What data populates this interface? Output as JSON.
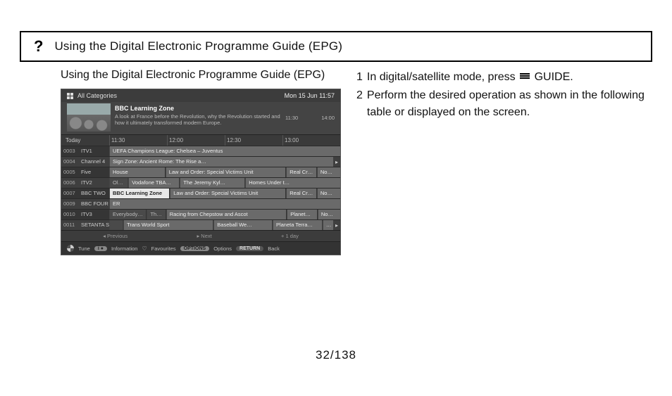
{
  "title_bar": {
    "icon_label": "?",
    "title": "Using the Digital Electronic Programme Guide (EPG)"
  },
  "subtitle": "Using the Digital Electronic Programme Guide (EPG)",
  "instructions": {
    "step1_num": "1",
    "step1_text_a": "In digital/satellite mode, press",
    "step1_text_b": "GUIDE.",
    "step2_num": "2",
    "step2_text": "Perform the desired operation as shown in the following table or displayed on the screen."
  },
  "epg": {
    "category": "All Categories",
    "clock": "Mon 15 Jun 11:57",
    "feature": {
      "title": "BBC Learning Zone",
      "desc": "A look at France before the Revolution, why the Revolution started and how it ultimately transformed modern Europe.",
      "start": "11:30",
      "end": "14:00"
    },
    "today_label": "Today",
    "time_slots": [
      "11:30",
      "12:00",
      "12:30",
      "13:00"
    ],
    "channels": [
      {
        "num": "0003",
        "name": "ITV1",
        "progs": [
          {
            "label": "UEFA Champions League: Chelsea – Juventus",
            "w": 100,
            "cls": ""
          }
        ]
      },
      {
        "num": "0004",
        "name": "Channel 4",
        "progs": [
          {
            "label": "Sign Zone: Ancient Rome: The Rise a…",
            "w": 100,
            "cls": ""
          }
        ],
        "arrow": "▸"
      },
      {
        "num": "0005",
        "name": "Five",
        "progs": [
          {
            "label": "House",
            "w": 24,
            "cls": ""
          },
          {
            "label": "Law and Order: Special Victims Unit",
            "w": 52,
            "cls": ""
          },
          {
            "label": "Real Cr…",
            "w": 13,
            "cls": ""
          },
          {
            "label": "No…",
            "w": 11,
            "cls": ""
          }
        ]
      },
      {
        "num": "0006",
        "name": "ITV2",
        "progs": [
          {
            "label": "Ol…",
            "w": 8,
            "cls": "dark"
          },
          {
            "label": "Vodafone TBA…",
            "w": 22,
            "cls": ""
          },
          {
            "label": "The Jeremy Kyl…",
            "w": 28,
            "cls": ""
          },
          {
            "label": "Homes Under t…",
            "w": 42,
            "cls": ""
          }
        ]
      },
      {
        "num": "0007",
        "name": "BBC TWO",
        "progs": [
          {
            "label": "BBC Learning Zone",
            "w": 26,
            "cls": "hl"
          },
          {
            "label": "Law and Order: Special Victims Unit",
            "w": 50,
            "cls": ""
          },
          {
            "label": "Real Cr…",
            "w": 13,
            "cls": ""
          },
          {
            "label": "No…",
            "w": 11,
            "cls": ""
          }
        ]
      },
      {
        "num": "0009",
        "name": "BBC FOUR",
        "progs": [
          {
            "label": "ER",
            "w": 100,
            "cls": ""
          }
        ]
      },
      {
        "num": "0010",
        "name": "ITV3",
        "progs": [
          {
            "label": "Everybody…",
            "w": 16,
            "cls": "dark"
          },
          {
            "label": "Th…",
            "w": 8,
            "cls": "dark"
          },
          {
            "label": "Racing from Chepstow and Ascot",
            "w": 52,
            "cls": ""
          },
          {
            "label": "Planet…",
            "w": 13,
            "cls": ""
          },
          {
            "label": "No…",
            "w": 11,
            "cls": ""
          }
        ]
      },
      {
        "num": "0011",
        "name": "SETANTA SP…",
        "progs": [
          {
            "label": "",
            "w": 6,
            "cls": "dark"
          },
          {
            "label": "Trans World Sport",
            "w": 40,
            "cls": ""
          },
          {
            "label": "Baseball We…",
            "w": 26,
            "cls": ""
          },
          {
            "label": "Planeta Terra…",
            "w": 22,
            "cls": ""
          },
          {
            "label": "…",
            "w": 6,
            "cls": ""
          }
        ],
        "arrow": "▸"
      }
    ],
    "nav": {
      "prev": "◂  Previous",
      "next": "▸  Next",
      "plus": "+ 1 day"
    },
    "footer": {
      "tune": "Tune",
      "info_pill": "i ●",
      "info": "Information",
      "fav": "Favourites",
      "options_pill": "OPTIONS",
      "options": "Options",
      "return_pill": "RETURN",
      "back": "Back"
    }
  },
  "page_number": "32/138"
}
